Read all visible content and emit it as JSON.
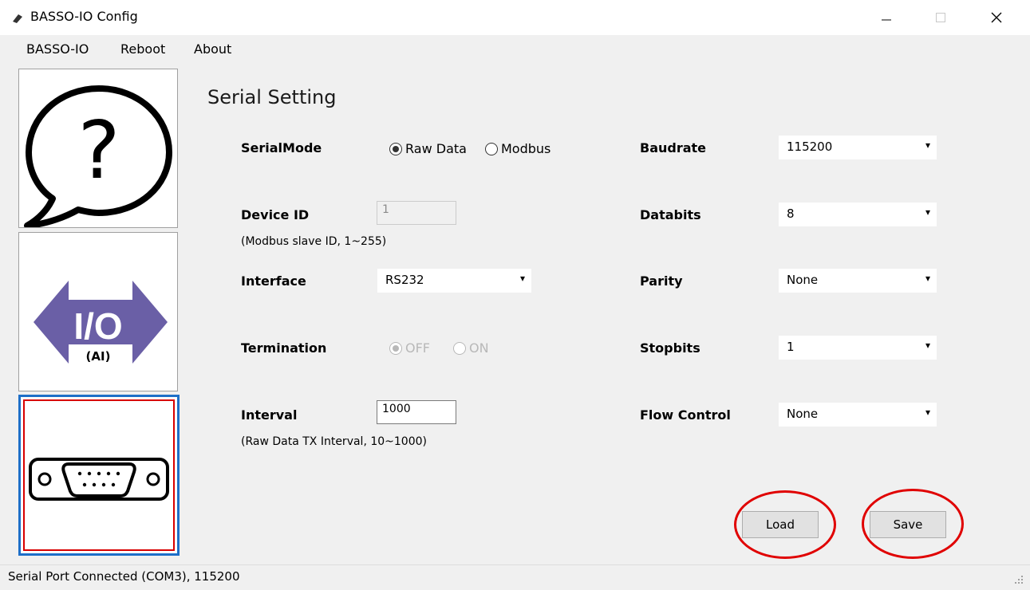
{
  "window": {
    "title": "BASSO-IO Config"
  },
  "menu": {
    "items": [
      "BASSO-IO",
      "Reboot",
      "About"
    ]
  },
  "sidebar": {
    "help_icon": "question-bubble-icon",
    "io_label": "I/O",
    "io_sub": "(AI)",
    "serial_icon": "db9-connector-icon"
  },
  "main": {
    "title": "Serial Setting",
    "serial_mode": {
      "label": "SerialMode",
      "options": [
        "Raw Data",
        "Modbus"
      ],
      "selected": "Raw Data"
    },
    "device_id": {
      "label": "Device ID",
      "value": "1",
      "hint": "(Modbus slave ID, 1~255)"
    },
    "interface": {
      "label": "Interface",
      "value": "RS232"
    },
    "termination": {
      "label": "Termination",
      "options": [
        "OFF",
        "ON"
      ],
      "selected": "OFF"
    },
    "interval": {
      "label": "Interval",
      "value": "1000",
      "hint": "(Raw Data TX Interval, 10~1000)"
    },
    "baudrate": {
      "label": "Baudrate",
      "value": "115200"
    },
    "databits": {
      "label": "Databits",
      "value": "8"
    },
    "parity": {
      "label": "Parity",
      "value": "None"
    },
    "stopbits": {
      "label": "Stopbits",
      "value": "1"
    },
    "flow_control": {
      "label": "Flow Control",
      "value": "None"
    },
    "load_label": "Load",
    "save_label": "Save"
  },
  "status": {
    "text": "Serial Port Connected (COM3), 115200"
  },
  "colors": {
    "highlight_circle": "#e00000",
    "selected_border_outer": "#1e6fc8",
    "selected_border_inner": "#d80000",
    "io_arrow": "#6a5fa6"
  }
}
